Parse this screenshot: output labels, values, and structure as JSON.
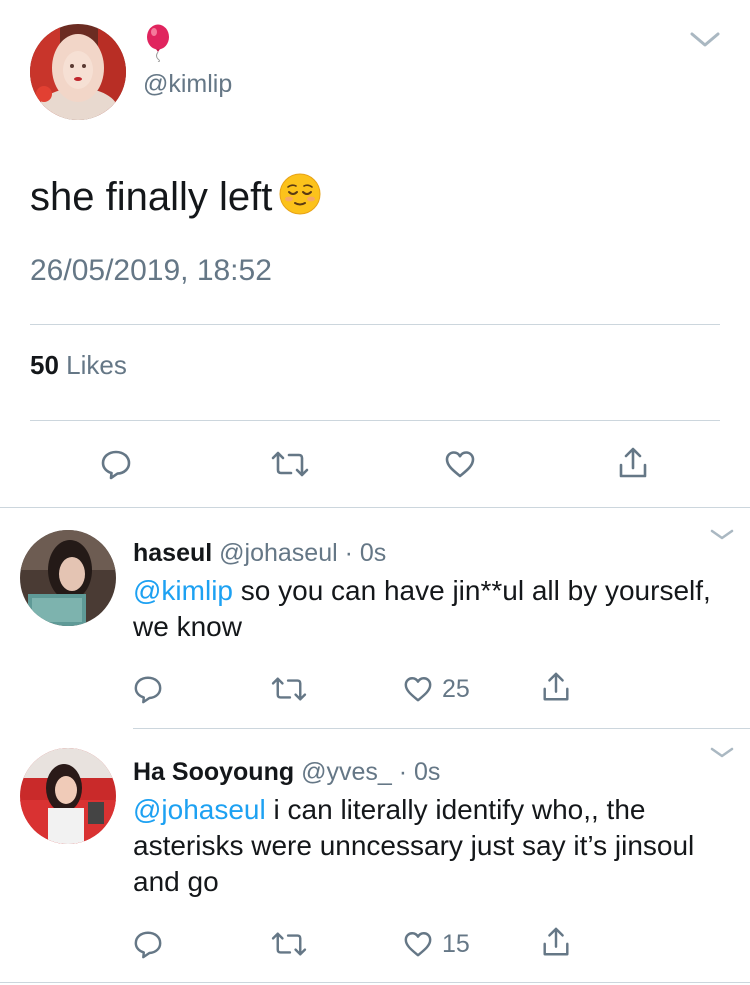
{
  "main_tweet": {
    "handle": "@kimlip",
    "text": "she finally left",
    "emoji": "relieved-face-icon",
    "timestamp": "26/05/2019, 18:52",
    "likes_count": "50",
    "likes_label": "Likes"
  },
  "replies": [
    {
      "name": "haseul",
      "handle": "@johaseul",
      "time": "0s",
      "mention": "@kimlip",
      "text": " so you can have jin**ul all by yourself, we know",
      "likes": "25"
    },
    {
      "name": "Ha Sooyoung",
      "handle": "@yves_",
      "time": "0s",
      "mention": "@johaseul",
      "text": " i can literally identify who,, the asterisks were unncessary just say it’s jinsoul and go",
      "likes": "15"
    }
  ],
  "colors": {
    "link": "#1da1f2",
    "secondary_text": "#657786",
    "divider": "#ccd6dd",
    "balloon": "#e0245e"
  }
}
